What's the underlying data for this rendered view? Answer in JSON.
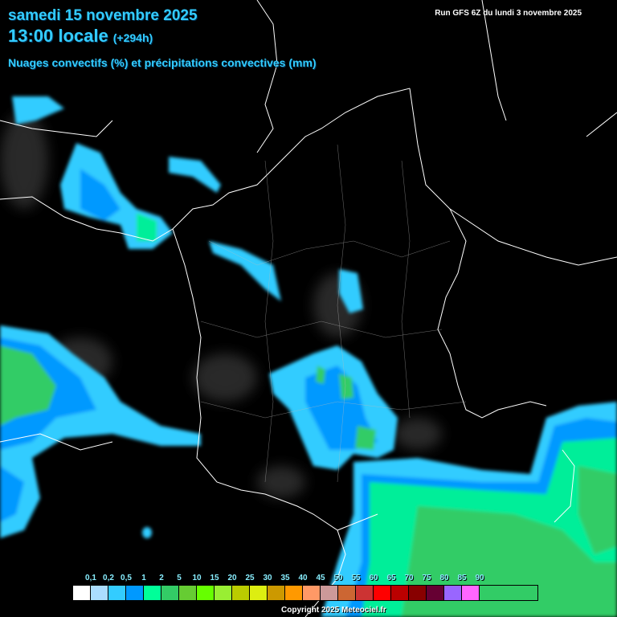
{
  "header": {
    "date": "samedi 15 novembre 2025",
    "time": "13:00 locale",
    "lead": "(+294h)",
    "subtitle": "Nuages convectifs (%) et précipitations convectives (mm)",
    "run": "Run GFS 6Z du lundi 3 novembre 2025"
  },
  "legend": {
    "labels": [
      "0,1",
      "0,2",
      "0,5",
      "1",
      "2",
      "5",
      "10",
      "15",
      "20",
      "25",
      "30",
      "35",
      "40",
      "45",
      "50",
      "55",
      "60",
      "65",
      "70",
      "75",
      "80",
      "85",
      "90"
    ],
    "colors": [
      "#ffffff",
      "#aaddff",
      "#33ccff",
      "#0099ff",
      "#00ff99",
      "#33cc66",
      "#66cc33",
      "#66ff00",
      "#99ee33",
      "#bbcc00",
      "#ddee11",
      "#cc9900",
      "#ff9900",
      "#ff9966",
      "#cc9999",
      "#cc6633",
      "#cc3333",
      "#ff0000",
      "#bb0000",
      "#880000",
      "#660033",
      "#9966ff",
      "#ff66ff"
    ]
  },
  "copyright": "Copyright 2025 Meteociel.fr"
}
